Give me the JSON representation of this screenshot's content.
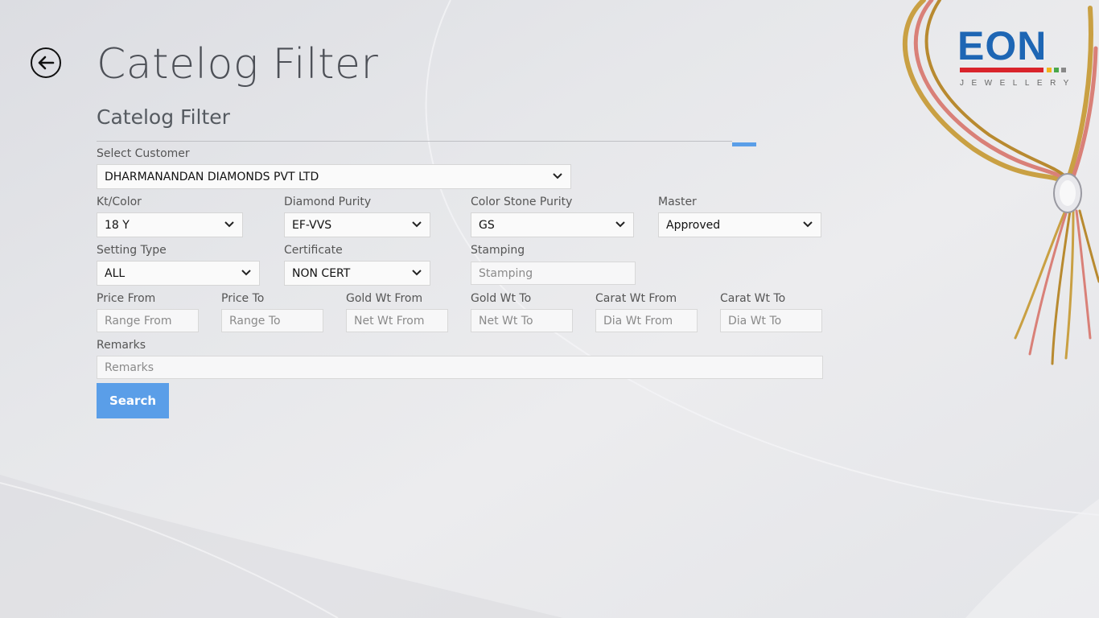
{
  "page": {
    "title": "Catelog Filter",
    "subtitle": "Catelog Filter"
  },
  "brand": {
    "name": "EON",
    "tagline": "JEWELLERY",
    "color": "#1e66b4",
    "bar_color": "#d9242b"
  },
  "accent": "#5a9ee8",
  "form": {
    "customer": {
      "label": "Select Customer",
      "value": "DHARMANANDAN DIAMONDS PVT LTD"
    },
    "kt_color": {
      "label": "Kt/Color",
      "value": "18 Y"
    },
    "diamond_purity": {
      "label": "Diamond Purity",
      "value": "EF-VVS"
    },
    "color_stone_purity": {
      "label": "Color Stone Purity",
      "value": "GS"
    },
    "master": {
      "label": "Master",
      "value": "Approved"
    },
    "setting_type": {
      "label": "Setting Type",
      "value": "ALL"
    },
    "certificate": {
      "label": "Certificate",
      "value": "NON CERT"
    },
    "stamping": {
      "label": "Stamping",
      "placeholder": "Stamping"
    },
    "price_from": {
      "label": "Price From",
      "placeholder": "Range From"
    },
    "price_to": {
      "label": "Price To",
      "placeholder": "Range To"
    },
    "gold_wt_from": {
      "label": "Gold Wt From",
      "placeholder": "Net Wt From"
    },
    "gold_wt_to": {
      "label": "Gold Wt To",
      "placeholder": "Net Wt To"
    },
    "carat_wt_from": {
      "label": "Carat Wt From",
      "placeholder": "Dia Wt From"
    },
    "carat_wt_to": {
      "label": "Carat Wt To",
      "placeholder": "Dia Wt To"
    },
    "remarks": {
      "label": "Remarks",
      "placeholder": "Remarks"
    },
    "search_label": "Search"
  },
  "icons": {
    "back": "back-arrow-icon",
    "dropdown": "chevron-down-icon"
  }
}
